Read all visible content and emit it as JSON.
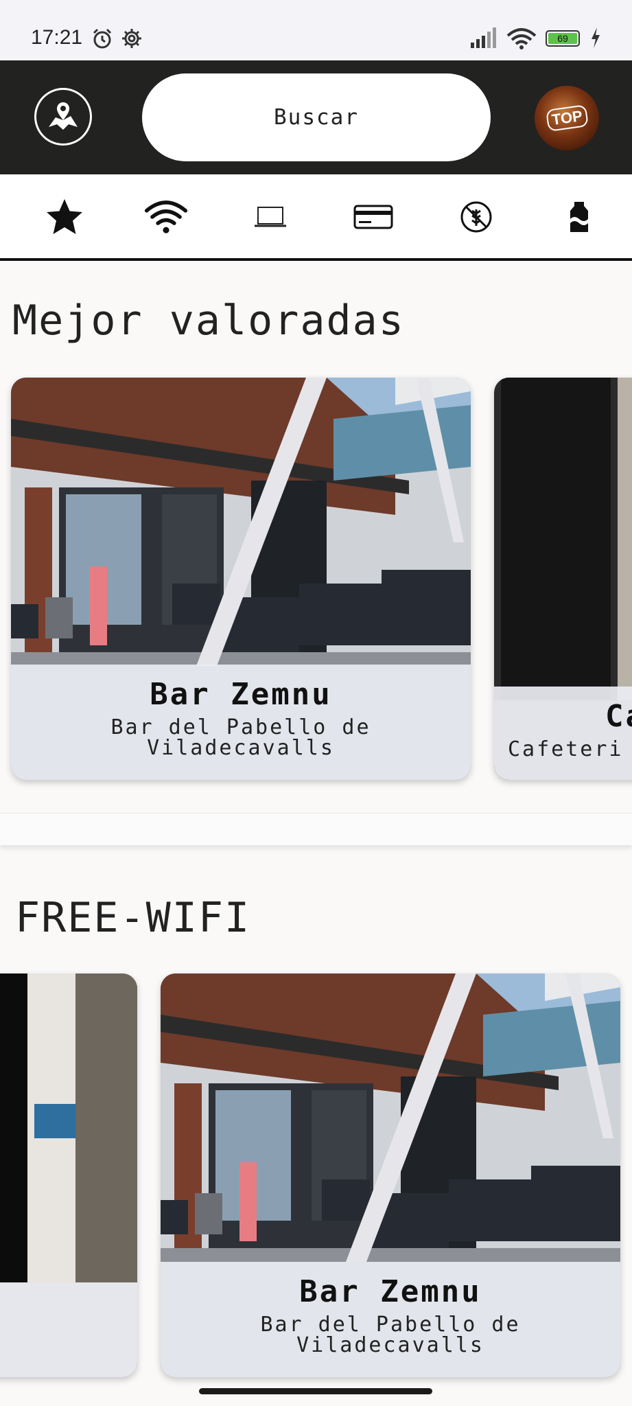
{
  "status_bar": {
    "time": "17:21",
    "battery": "69"
  },
  "header": {
    "search_label": "Buscar",
    "logo_text": "TOP"
  },
  "filters": [
    {
      "icon": "star-icon"
    },
    {
      "icon": "wifi-icon"
    },
    {
      "icon": "laptop-icon"
    },
    {
      "icon": "credit-card-icon"
    },
    {
      "icon": "gluten-free-icon"
    },
    {
      "icon": "milk-carton-icon"
    }
  ],
  "sections": [
    {
      "title": "Mejor valoradas",
      "cards": [
        {
          "title": "Bar Zemnu",
          "subtitle_line1": "Bar del Pabello de",
          "subtitle_line2": "Viladecavalls"
        },
        {
          "title": "Ca",
          "subtitle_line1": "Cafeteri"
        }
      ]
    },
    {
      "title": "FREE-WIFI",
      "cards": [
        {
          "title": "Bar Zemnu",
          "subtitle_line1": "Bar del Pabello de",
          "subtitle_line2": "Viladecavalls"
        }
      ]
    }
  ],
  "colors": {
    "header_bg": "#222221",
    "page_bg": "#faf9f8",
    "caption_bg": "#eaecf2"
  }
}
